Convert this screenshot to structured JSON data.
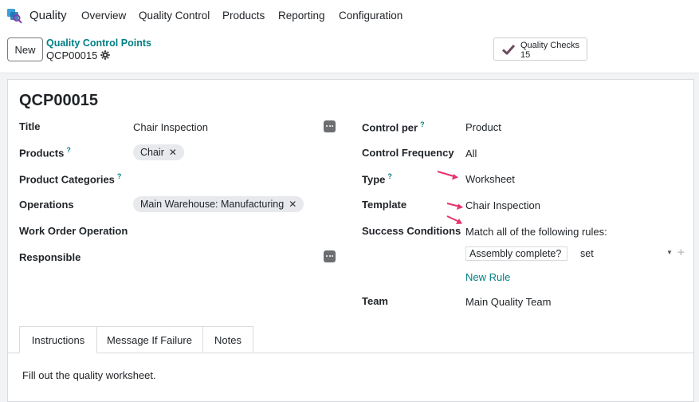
{
  "nav": {
    "app_name": "Quality",
    "menu": [
      "Overview",
      "Quality Control",
      "Products",
      "Reporting",
      "Configuration"
    ]
  },
  "control_panel": {
    "new_label": "New",
    "breadcrumb_parent": "Quality Control Points",
    "breadcrumb_current": "QCP00015",
    "smart_button": {
      "label": "Quality Checks",
      "count": "15"
    }
  },
  "record": {
    "title": "QCP00015",
    "left_fields": {
      "title_label": "Title",
      "title_value": "Chair Inspection",
      "products_label": "Products",
      "products_tags": [
        "Chair"
      ],
      "product_categories_label": "Product Categories",
      "operations_label": "Operations",
      "operations_tags": [
        "Main Warehouse: Manufacturing"
      ],
      "work_order_label": "Work Order Operation",
      "responsible_label": "Responsible"
    },
    "right_fields": {
      "control_per_label": "Control per",
      "control_per_value": "Product",
      "frequency_label": "Control Frequency",
      "frequency_value": "All",
      "type_label": "Type",
      "type_value": "Worksheet",
      "template_label": "Template",
      "template_value": "Chair Inspection",
      "success_label": "Success Conditions",
      "success_value": "Match all of the following rules:",
      "rule_field": "Assembly complete?",
      "rule_operator": "set",
      "new_rule": "New Rule",
      "team_label": "Team",
      "team_value": "Main Quality Team"
    },
    "help_marker": "?"
  },
  "tabs": {
    "items": [
      "Instructions",
      "Message If Failure",
      "Notes"
    ],
    "active": "Instructions",
    "content": "Fill out the quality worksheet."
  },
  "colors": {
    "accent": "#017e84",
    "annotation_arrow": "#e8336b",
    "tag_bg": "#e7e9ed"
  }
}
